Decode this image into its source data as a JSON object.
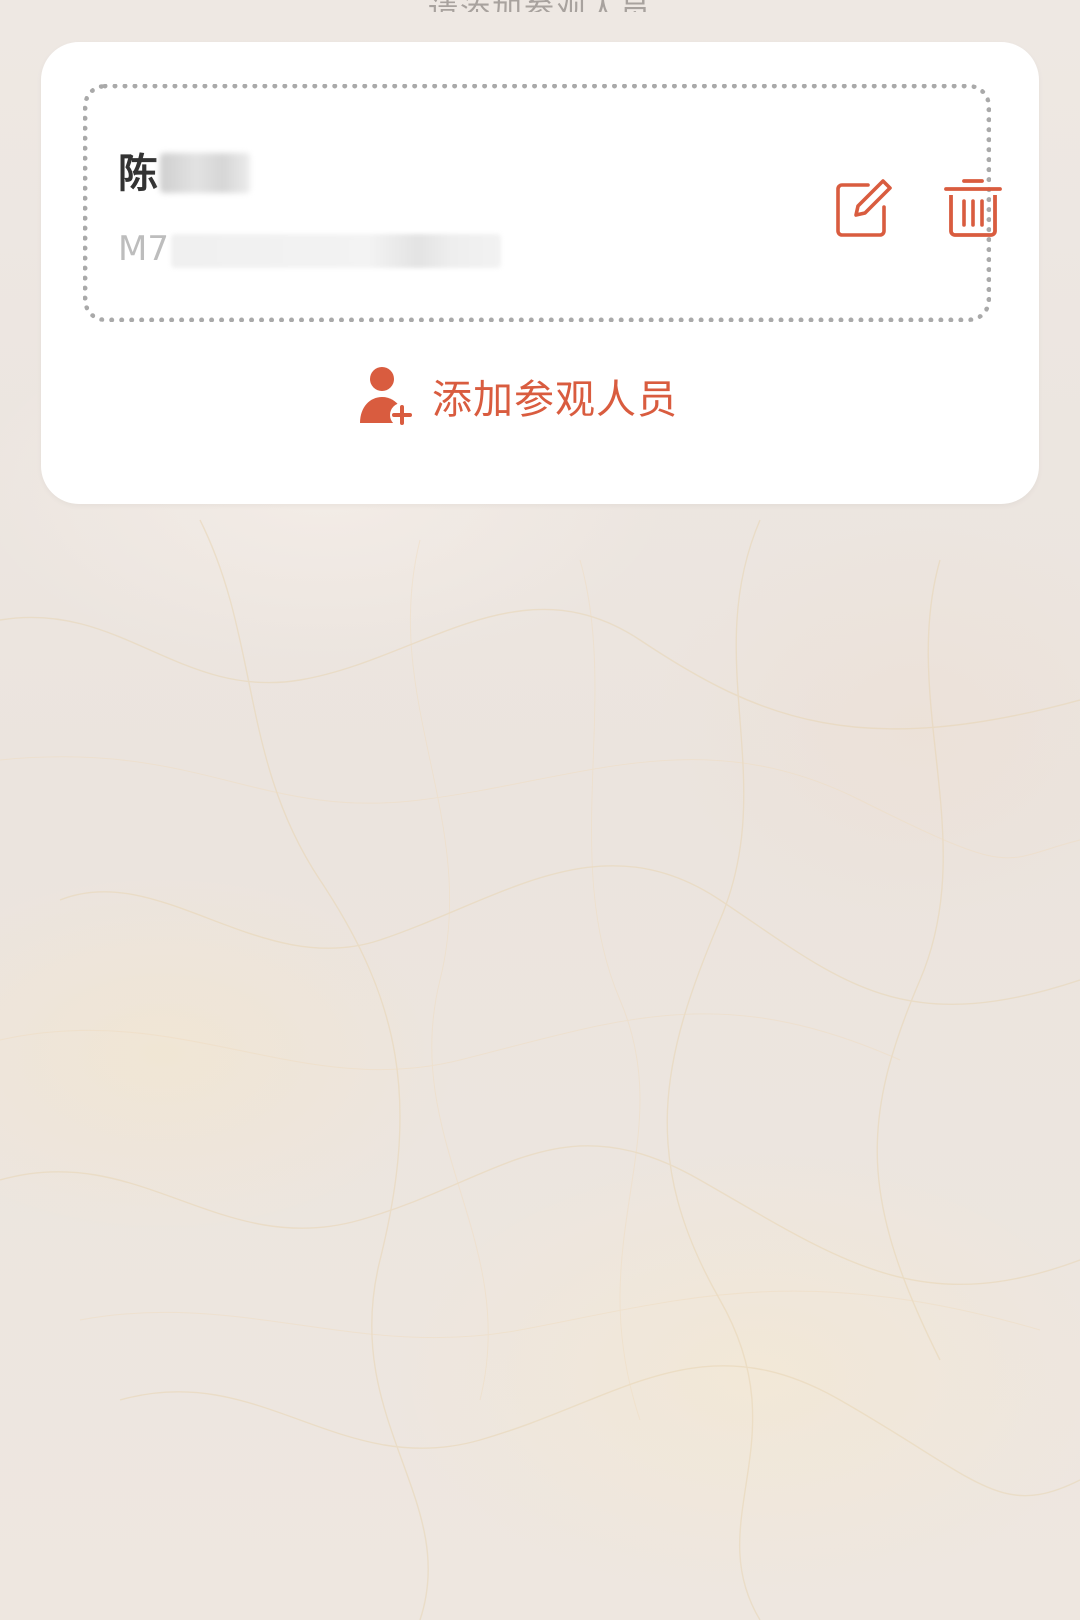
{
  "page": {
    "top_hint": "请添加参观人员"
  },
  "visitor_card": {
    "name": "陈",
    "id_prefix": "M7",
    "icons": {
      "edit": "edit-icon",
      "delete": "trash-icon",
      "add": "add-person-icon"
    }
  },
  "add_visitor": {
    "label": "添加参观人员"
  },
  "colors": {
    "accent": "#d95c3f",
    "name_text": "#333333",
    "id_text": "#bdbdbd",
    "card_bg": "#ffffff",
    "dotted_border": "#a9a9a9"
  }
}
